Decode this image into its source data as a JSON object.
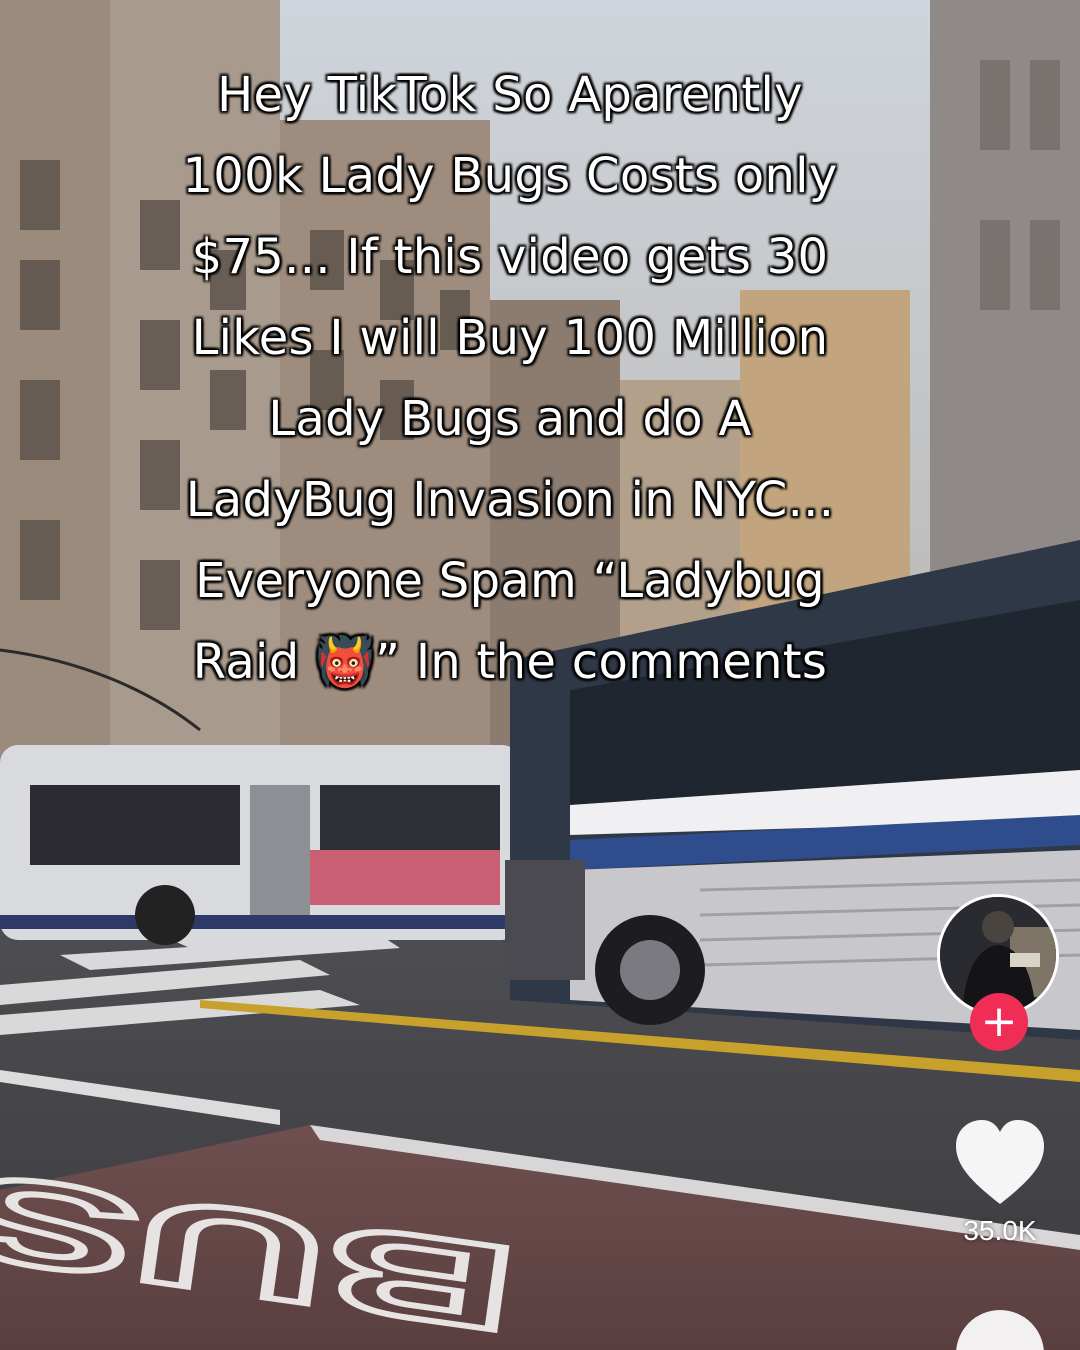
{
  "caption": {
    "lines": [
      "Hey TikTok So Aparently",
      "100k Lady Bugs Costs only",
      "$75... If this video gets 30",
      "Likes I will Buy 100 Million",
      "Lady Bugs and do A",
      "LadyBug Invasion in NYC...",
      "Everyone Spam “Ladybug",
      "Raid 👹” In the comments"
    ]
  },
  "sidebar": {
    "follow_label": "+",
    "like_count": "35.0K",
    "like_icon": "heart-icon",
    "comment_icon": "comment-bubble-icon"
  },
  "background": {
    "street_marking": "BUS"
  },
  "colors": {
    "follow_button": "#ef2d55",
    "like_icon": "#ffffff",
    "caption_text": "#ffffff"
  }
}
